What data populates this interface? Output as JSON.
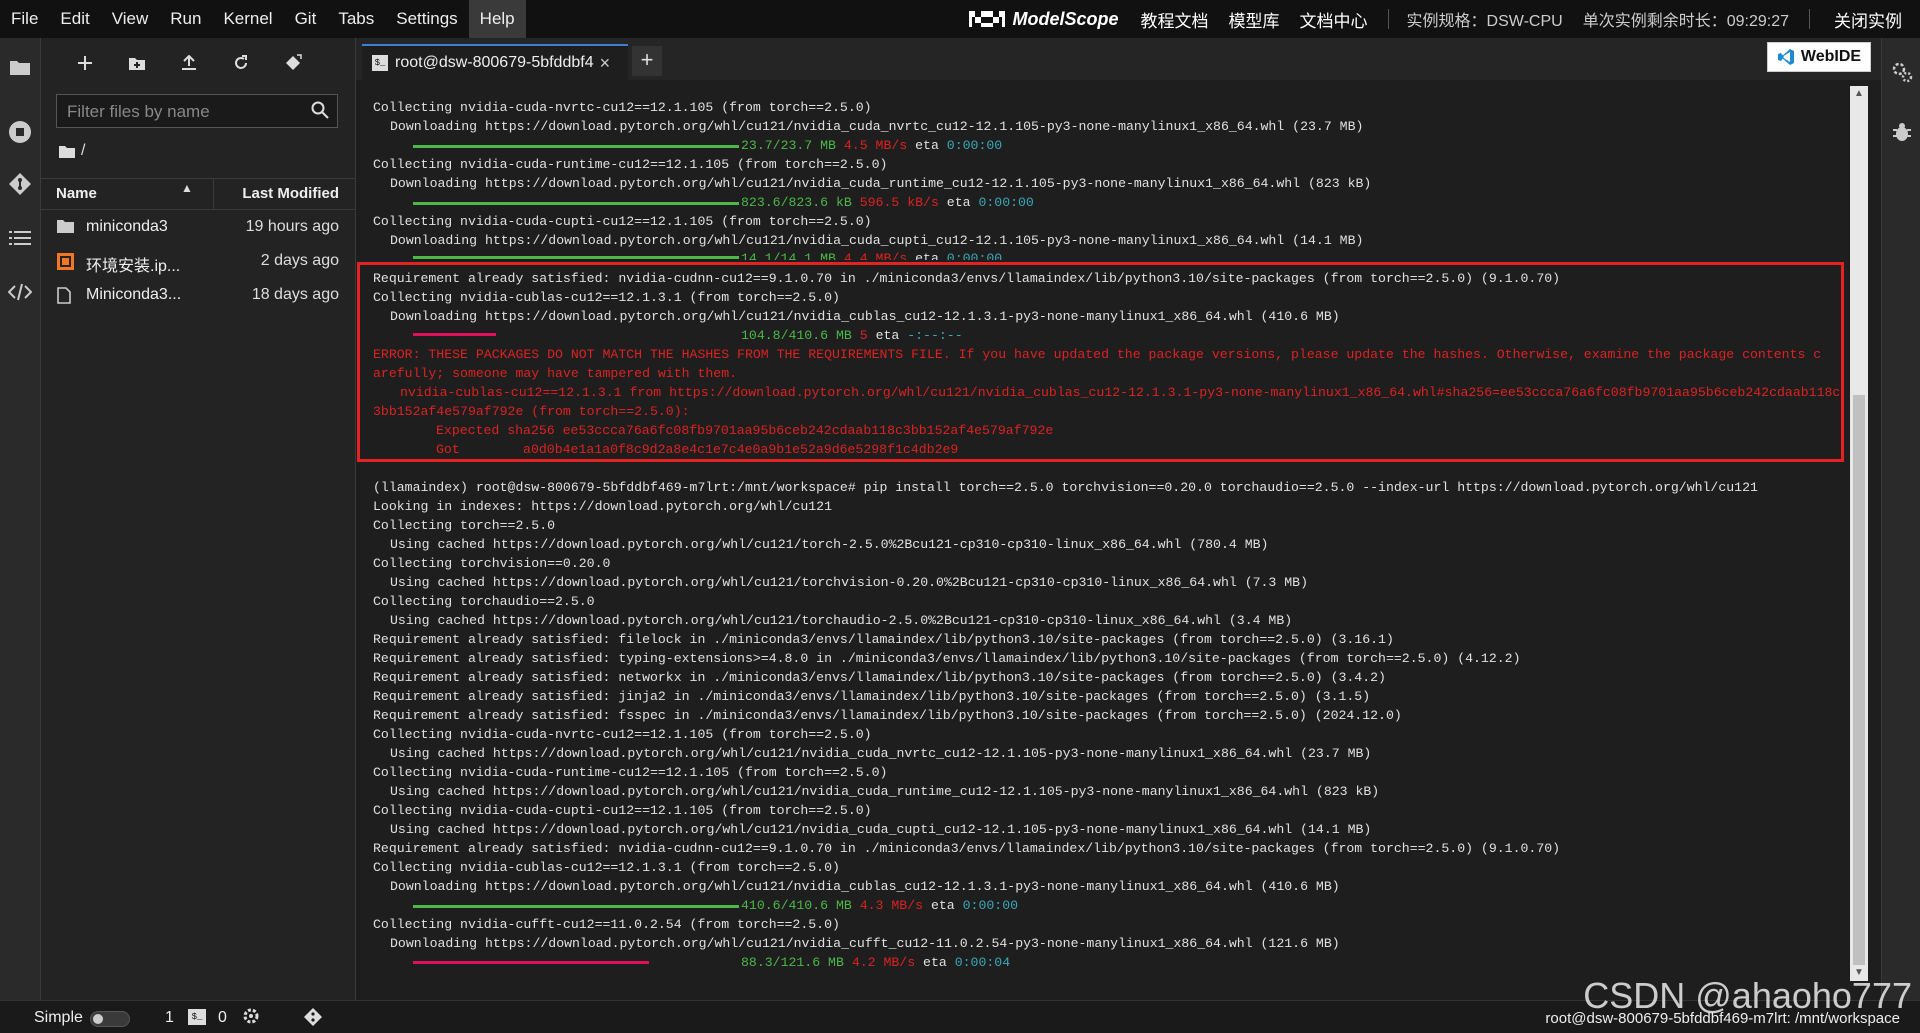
{
  "menubar": {
    "items": [
      "File",
      "Edit",
      "View",
      "Run",
      "Kernel",
      "Git",
      "Tabs",
      "Settings",
      "Help"
    ],
    "active": "Help",
    "logo_text": "ModelScope",
    "links": [
      "教程文档",
      "模型库",
      "文档中心"
    ],
    "spec": "实例规格：DSW-CPU",
    "remaining": "单次实例剩余时长：09:29:27",
    "close": "关闭实例"
  },
  "filebrowser": {
    "filter_placeholder": "Filter files by name",
    "breadcrumb": "/",
    "col_name": "Name",
    "col_modified": "Last Modified",
    "files": [
      {
        "icon": "folder-icon",
        "name": "miniconda3",
        "modified": "19 hours ago"
      },
      {
        "icon": "notebook-icon",
        "name": "环境安装.ip...",
        "modified": "2 days ago"
      },
      {
        "icon": "file-icon",
        "name": "Miniconda3...",
        "modified": "18 days ago"
      }
    ]
  },
  "tabs": {
    "terminal_tab": "root@dsw-800679-5bfddbf4",
    "add": "+",
    "webide": "WebIDE"
  },
  "terminal": {
    "l1": "Collecting nvidia-cuda-nvrtc-cu12==12.1.105 (from torch==2.5.0)",
    "l2": "Downloading https://download.pytorch.org/whl/cu121/nvidia_cuda_nvrtc_cu12-12.1.105-py3-none-manylinux1_x86_64.whl (23.7 MB)",
    "l3a": "23.7/23.7 MB",
    "l3b": "4.5 MB/s",
    "l3c": "eta",
    "l3d": "0:00:00",
    "l4": "Collecting nvidia-cuda-runtime-cu12==12.1.105 (from torch==2.5.0)",
    "l5": "Downloading https://download.pytorch.org/whl/cu121/nvidia_cuda_runtime_cu12-12.1.105-py3-none-manylinux1_x86_64.whl (823 kB)",
    "l6a": "823.6/823.6 kB",
    "l6b": "596.5 kB/s",
    "l6c": "eta",
    "l6d": "0:00:00",
    "l7": "Collecting nvidia-cuda-cupti-cu12==12.1.105 (from torch==2.5.0)",
    "l8": "Downloading https://download.pytorch.org/whl/cu121/nvidia_cuda_cupti_cu12-12.1.105-py3-none-manylinux1_x86_64.whl (14.1 MB)",
    "l9a": "14.1/14.1 MB",
    "l9b": "4.4 MB/s",
    "l9c": "eta",
    "l9d": "0:00:00",
    "l10": "Requirement already satisfied: nvidia-cudnn-cu12==9.1.0.70 in ./miniconda3/envs/llamaindex/lib/python3.10/site-packages (from torch==2.5.0) (9.1.0.70)",
    "l11": "Collecting nvidia-cublas-cu12==12.1.3.1 (from torch==2.5.0)",
    "l12": "Downloading https://download.pytorch.org/whl/cu121/nvidia_cublas_cu12-12.1.3.1-py3-none-manylinux1_x86_64.whl (410.6 MB)",
    "l13a": "104.8/410.6 MB",
    "l13b": "5",
    "l13c": "eta",
    "l13d": "-:--:--",
    "l14": "ERROR: THESE PACKAGES DO NOT MATCH THE HASHES FROM THE REQUIREMENTS FILE. If you have updated the package versions, please update the hashes. Otherwise, examine the package contents c",
    "l15": "arefully; someone may have tampered with them.",
    "l16": "nvidia-cublas-cu12==12.1.3.1 from https://download.pytorch.org/whl/cu121/nvidia_cublas_cu12-12.1.3.1-py3-none-manylinux1_x86_64.whl#sha256=ee53ccca76a6fc08fb9701aa95b6ceb242cdaab118c",
    "l17": "3bb152af4e579af792e (from torch==2.5.0):",
    "l18": "Expected sha256 ee53ccca76a6fc08fb9701aa95b6ceb242cdaab118c3bb152af4e579af792e",
    "l19": "Got        a0d0b4e1a1a0f8c9d2a8e4c1e7c4e0a9b1e52a9d6e5298f1c4db2e9",
    "l20": "(llamaindex) root@dsw-800679-5bfddbf469-m7lrt:/mnt/workspace# pip install torch==2.5.0 torchvision==0.20.0 torchaudio==2.5.0 --index-url https://download.pytorch.org/whl/cu121",
    "l21": "Looking in indexes: https://download.pytorch.org/whl/cu121",
    "l22": "Collecting torch==2.5.0",
    "l23": "Using cached https://download.pytorch.org/whl/cu121/torch-2.5.0%2Bcu121-cp310-cp310-linux_x86_64.whl (780.4 MB)",
    "l24": "Collecting torchvision==0.20.0",
    "l25": "Using cached https://download.pytorch.org/whl/cu121/torchvision-0.20.0%2Bcu121-cp310-cp310-linux_x86_64.whl (7.3 MB)",
    "l26": "Collecting torchaudio==2.5.0",
    "l27": "Using cached https://download.pytorch.org/whl/cu121/torchaudio-2.5.0%2Bcu121-cp310-cp310-linux_x86_64.whl (3.4 MB)",
    "l28": "Requirement already satisfied: filelock in ./miniconda3/envs/llamaindex/lib/python3.10/site-packages (from torch==2.5.0) (3.16.1)",
    "l29": "Requirement already satisfied: typing-extensions>=4.8.0 in ./miniconda3/envs/llamaindex/lib/python3.10/site-packages (from torch==2.5.0) (4.12.2)",
    "l30": "Requirement already satisfied: networkx in ./miniconda3/envs/llamaindex/lib/python3.10/site-packages (from torch==2.5.0) (3.4.2)",
    "l31": "Requirement already satisfied: jinja2 in ./miniconda3/envs/llamaindex/lib/python3.10/site-packages (from torch==2.5.0) (3.1.5)",
    "l32": "Requirement already satisfied: fsspec in ./miniconda3/envs/llamaindex/lib/python3.10/site-packages (from torch==2.5.0) (2024.12.0)",
    "l33": "Collecting nvidia-cuda-nvrtc-cu12==12.1.105 (from torch==2.5.0)",
    "l34": "Using cached https://download.pytorch.org/whl/cu121/nvidia_cuda_nvrtc_cu12-12.1.105-py3-none-manylinux1_x86_64.whl (23.7 MB)",
    "l35": "Collecting nvidia-cuda-runtime-cu12==12.1.105 (from torch==2.5.0)",
    "l36": "Using cached https://download.pytorch.org/whl/cu121/nvidia_cuda_runtime_cu12-12.1.105-py3-none-manylinux1_x86_64.whl (823 kB)",
    "l37": "Collecting nvidia-cuda-cupti-cu12==12.1.105 (from torch==2.5.0)",
    "l38": "Using cached https://download.pytorch.org/whl/cu121/nvidia_cuda_cupti_cu12-12.1.105-py3-none-manylinux1_x86_64.whl (14.1 MB)",
    "l39": "Requirement already satisfied: nvidia-cudnn-cu12==9.1.0.70 in ./miniconda3/envs/llamaindex/lib/python3.10/site-packages (from torch==2.5.0) (9.1.0.70)",
    "l40": "Collecting nvidia-cublas-cu12==12.1.3.1 (from torch==2.5.0)",
    "l41": "Downloading https://download.pytorch.org/whl/cu121/nvidia_cublas_cu12-12.1.3.1-py3-none-manylinux1_x86_64.whl (410.6 MB)",
    "l42a": "410.6/410.6 MB",
    "l42b": "4.3 MB/s",
    "l42c": "eta",
    "l42d": "0:00:00",
    "l43": "Collecting nvidia-cufft-cu12==11.0.2.54 (from torch==2.5.0)",
    "l44": "Downloading https://download.pytorch.org/whl/cu121/nvidia_cufft_cu12-11.0.2.54-py3-none-manylinux1_x86_64.whl (121.6 MB)",
    "l45a": "88.3/121.6 MB",
    "l45b": "4.2 MB/s",
    "l45c": "eta",
    "l45d": "0:00:04"
  },
  "progress": {
    "cublas_first_fraction": 0.255,
    "cufft_fraction": 0.726
  },
  "statusbar": {
    "simple": "Simple",
    "kernels": "1",
    "terminals": "0",
    "path": "root@dsw-800679-5bfddbf469-m7lrt: /mnt/workspace"
  },
  "watermark": "CSDN @ahaoho777",
  "colors": {
    "accent": "#3c7fd6",
    "highlight_box": "#e52222",
    "progress_done": "#4cb848",
    "progress_active": "#e0105a"
  }
}
